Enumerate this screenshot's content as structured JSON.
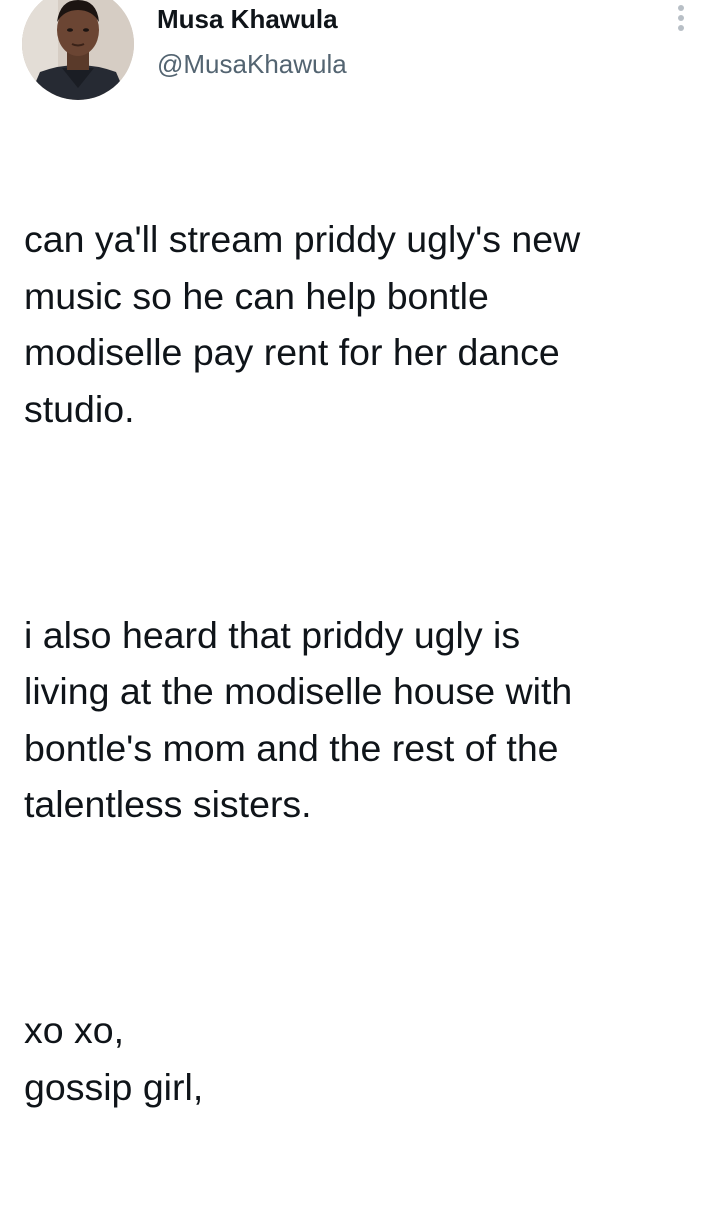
{
  "author": {
    "display_name": "Musa Khawula",
    "handle": "@MusaKhawula"
  },
  "icons": {
    "avatar": "profile-photo",
    "more": "more-vertical-icon"
  },
  "colors": {
    "text_primary": "#0f1419",
    "text_secondary": "#536471",
    "icon_muted": "#aab8c2"
  },
  "tweet": {
    "paragraphs": [
      "can ya'll stream priddy ugly's new\nmusic so he can help bontle\nmodiselle pay rent for her dance\nstudio.",
      "i also heard that priddy ugly is\nliving at the modiselle house with\nbontle's mom and the rest of the\ntalentless sisters.",
      "xo xo,\ngossip girl,"
    ]
  }
}
